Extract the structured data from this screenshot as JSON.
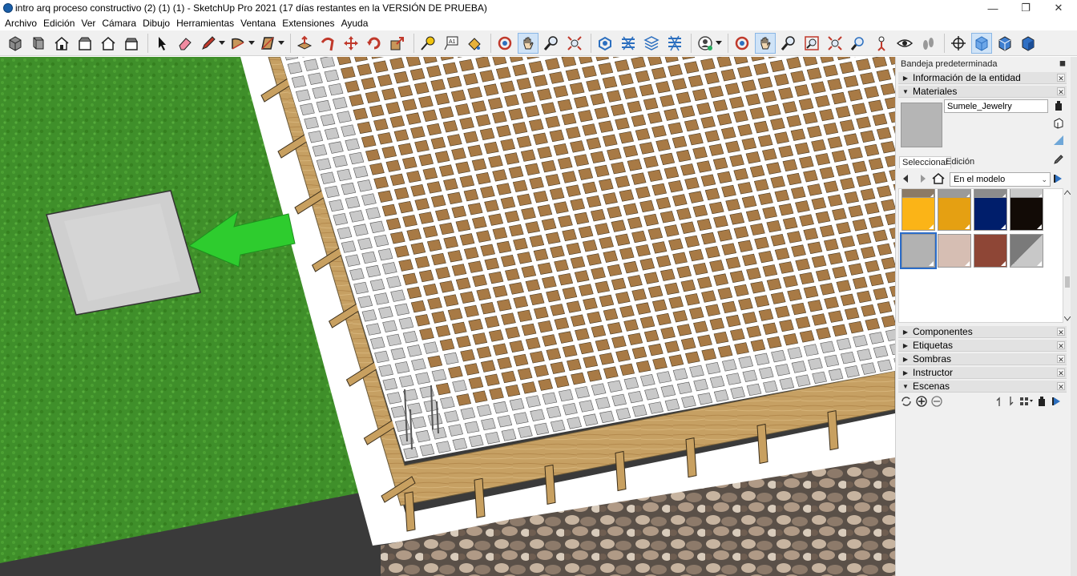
{
  "window": {
    "title": "intro arq proceso constructivo (2) (1) (1) - SketchUp Pro 2021 (17 días restantes en la VERSIÓN DE PRUEBA)",
    "minimize": "—",
    "maximize": "❐",
    "close": "✕"
  },
  "menu": [
    "Archivo",
    "Edición",
    "Ver",
    "Cámara",
    "Dibujo",
    "Herramientas",
    "Ventana",
    "Extensiones",
    "Ayuda"
  ],
  "toolbar_icons": [
    "iso-view-icon",
    "top-view-icon",
    "home-view-icon",
    "front-view-icon",
    "right-view-icon",
    "back-view-icon",
    "select-icon",
    "eraser-icon",
    "pencil-icon",
    "arc-icon",
    "rectangle-icon",
    "push-pull-icon",
    "follow-me-icon",
    "move-icon",
    "rotate-icon",
    "scale-icon",
    "tape-measure-icon",
    "text-icon",
    "paint-bucket-icon",
    "orbit-icon",
    "pan-icon",
    "zoom-icon",
    "zoom-extents-icon",
    "outer-shell-icon",
    "intersect-icon",
    "union-icon",
    "subtract-icon",
    "user-icon",
    "orbit2-icon",
    "pan2-icon",
    "zoom2-icon",
    "zoom-window-icon",
    "zoom-extents2-icon",
    "previous-view-icon",
    "position-camera-icon",
    "look-around-icon",
    "walk-icon",
    "section-plane-icon",
    "xray-icon",
    "back-edges-icon",
    "wireframe-icon"
  ],
  "tray": {
    "title": "Bandeja predeterminada",
    "pin": "📌"
  },
  "sections": {
    "entity_info": "Información de la entidad",
    "materials": "Materiales",
    "components": "Componentes",
    "tags": "Etiquetas",
    "shadows": "Sombras",
    "instructor": "Instructor",
    "scenes": "Escenas"
  },
  "materials": {
    "current_name": "Sumele_Jewelry",
    "tab_select": "Seleccionar",
    "tab_edit": "Edición",
    "collection": "En el modelo",
    "swatches": [
      {
        "color": "#8b7a66"
      },
      {
        "color": "#9a9a9a"
      },
      {
        "color": "#8c8c8c"
      },
      {
        "color": "#c9c9c9"
      },
      {
        "color": "#fbb417"
      },
      {
        "color": "#e5a012"
      },
      {
        "color": "#001e6b"
      },
      {
        "color": "#120b06"
      },
      {
        "color": "#b2b2b2"
      },
      {
        "color": "#d6beb3"
      },
      {
        "color": "#8e4636"
      },
      {
        "color": "#7a7a7a"
      }
    ]
  },
  "colors": {
    "grass": "#3f8f2a",
    "grid_cell": "#a87a45",
    "grid_cell_gray": "#c9c9c9",
    "arrow": "#2ecc2e",
    "asphalt": "#3a3a3a",
    "wood": "#c8a060"
  }
}
